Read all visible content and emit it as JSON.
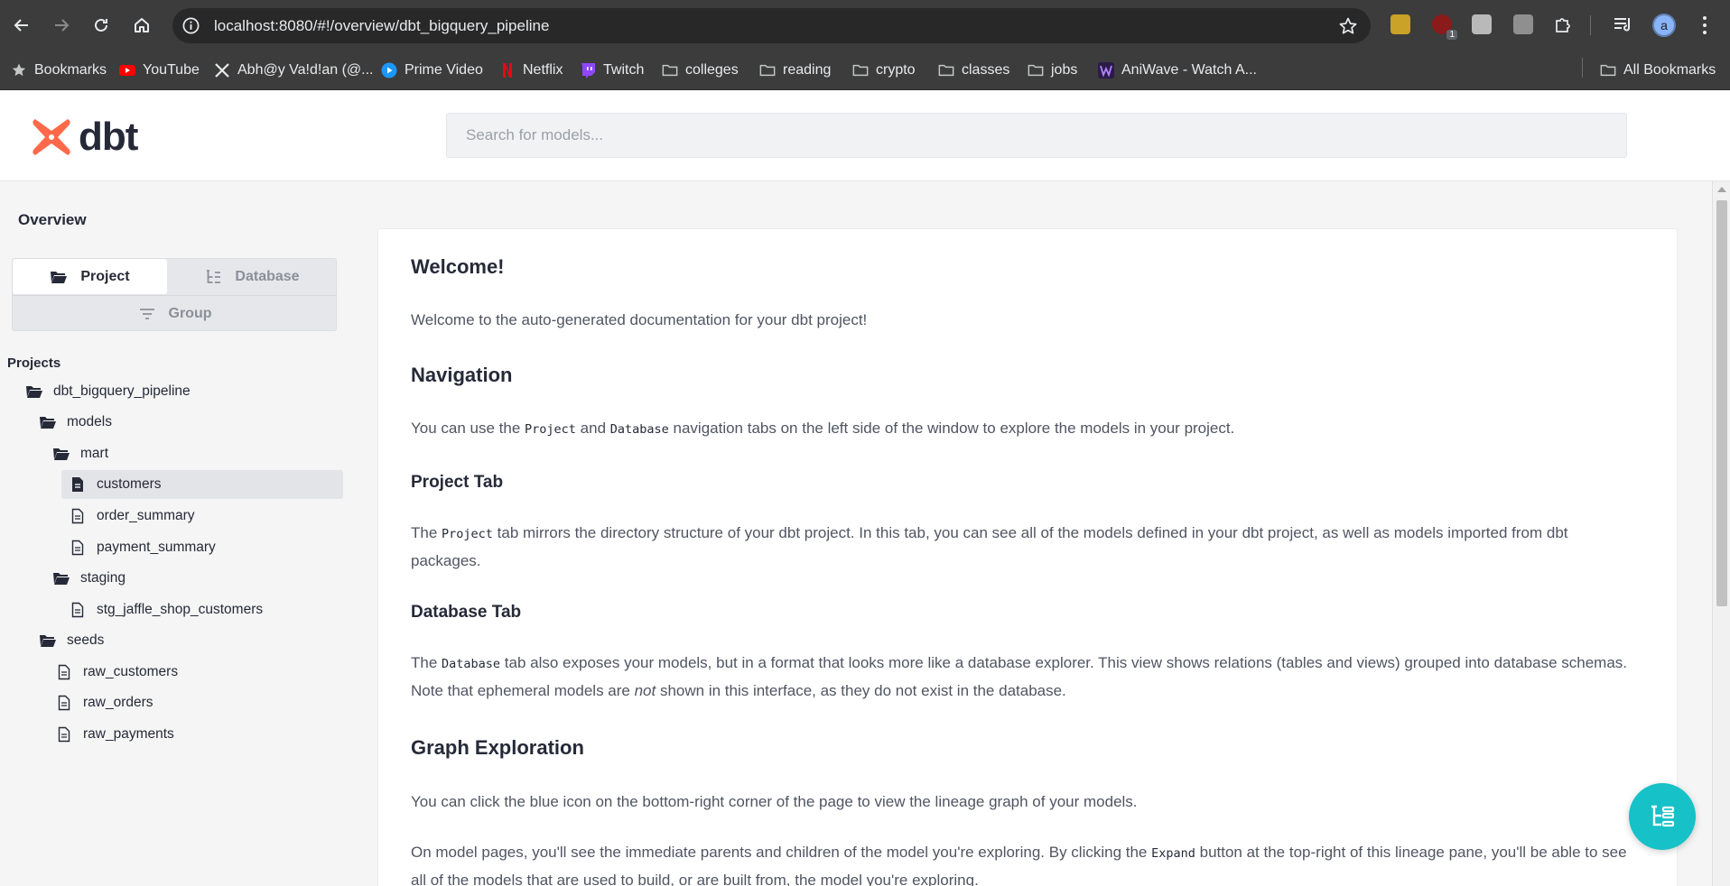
{
  "browser": {
    "url": "localhost:8080/#!/overview/dbt_bigquery_pipeline",
    "avatar_letter": "a",
    "extension_badge": "1",
    "bookmarks": [
      {
        "label": "Bookmarks",
        "icon": "star-icon"
      },
      {
        "label": "YouTube",
        "icon": "youtube-icon"
      },
      {
        "label": "Abh@y Va!d!an (@...",
        "icon": "x-icon"
      },
      {
        "label": "Prime Video",
        "icon": "prime-video-icon"
      },
      {
        "label": "Netflix",
        "icon": "netflix-icon"
      },
      {
        "label": "Twitch",
        "icon": "twitch-icon"
      },
      {
        "label": "colleges",
        "icon": "folder-icon"
      },
      {
        "label": "reading",
        "icon": "folder-icon"
      },
      {
        "label": "crypto",
        "icon": "folder-icon"
      },
      {
        "label": "classes",
        "icon": "folder-icon"
      },
      {
        "label": "jobs",
        "icon": "folder-icon"
      },
      {
        "label": "AniWave - Watch A...",
        "icon": "aniwave-icon"
      }
    ],
    "all_bookmarks": "All Bookmarks"
  },
  "app": {
    "logo_text": "dbt",
    "search_placeholder": "Search for models...",
    "accent": "#ff694a",
    "fab_color": "#16c1c7"
  },
  "sidebar": {
    "title": "Overview",
    "tabs": {
      "project": "Project",
      "database": "Database",
      "group": "Group"
    },
    "projects_label": "Projects",
    "tree": [
      {
        "label": "dbt_bigquery_pipeline",
        "type": "folder"
      },
      {
        "label": "models",
        "type": "folder"
      },
      {
        "label": "mart",
        "type": "folder"
      },
      {
        "label": "customers",
        "type": "file",
        "selected": true
      },
      {
        "label": "order_summary",
        "type": "file"
      },
      {
        "label": "payment_summary",
        "type": "file"
      },
      {
        "label": "staging",
        "type": "folder"
      },
      {
        "label": "stg_jaffle_shop_customers",
        "type": "file"
      },
      {
        "label": "seeds",
        "type": "folder"
      },
      {
        "label": "raw_customers",
        "type": "file"
      },
      {
        "label": "raw_orders",
        "type": "file"
      },
      {
        "label": "raw_payments",
        "type": "file"
      }
    ]
  },
  "content": {
    "welcome_title": "Welcome!",
    "welcome_text": "Welcome to the auto-generated documentation for your dbt project!",
    "navigation_title": "Navigation",
    "navigation_text": {
      "a": "You can use the ",
      "code1": "Project",
      "b": " and ",
      "code2": "Database",
      "c": " navigation tabs on the left side of the window to explore the models in your project."
    },
    "project_tab_title": "Project Tab",
    "project_tab_text": {
      "a": "The ",
      "code": "Project",
      "b": " tab mirrors the directory structure of your dbt project. In this tab, you can see all of the models defined in your dbt project, as well as models imported from dbt packages."
    },
    "database_tab_title": "Database Tab",
    "database_tab_text": {
      "a": "The ",
      "code": "Database",
      "b": " tab also exposes your models, but in a format that looks more like a database explorer. This view shows relations (tables and views) grouped into database schemas. Note that ephemeral models are ",
      "em": "not",
      "c": " shown in this interface, as they do not exist in the database."
    },
    "graph_title": "Graph Exploration",
    "graph_text_1": "You can click the blue icon on the bottom-right corner of the page to view the lineage graph of your models.",
    "graph_text_2": {
      "a": "On model pages, you'll see the immediate parents and children of the model you're exploring. By clicking the ",
      "code": "Expand",
      "b": " button at the top-right of this lineage pane, you'll be able to see all of the models that are used to build, or are built from, the model you're exploring."
    }
  }
}
